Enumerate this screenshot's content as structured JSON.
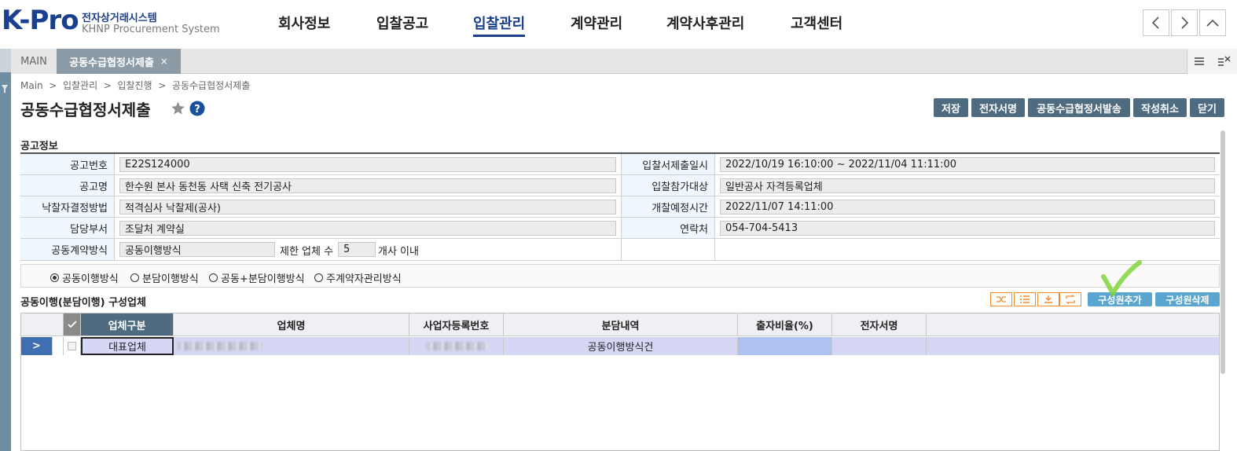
{
  "header": {
    "logo_main": "K-Pro",
    "logo_kr": "전자상거래시스템",
    "logo_en": "KHNP Procurement System",
    "nav": [
      "회사정보",
      "입찰공고",
      "입찰관리",
      "계약관리",
      "계약사후관리",
      "고객센터"
    ],
    "active_nav": "입찰관리"
  },
  "tabs": {
    "main": "MAIN",
    "active": "공동수급협정서제출",
    "close": "×"
  },
  "breadcrumb": "Main  >  입찰관리  >  입찰진행  >  공동수급협정서제출",
  "page_title": "공동수급협정서제출",
  "toolbar": {
    "save": "저장",
    "esign": "전자서명",
    "send": "공동수급협정서발송",
    "cancel": "작성취소",
    "close": "닫기"
  },
  "notice_section": "공고정보",
  "notice": {
    "no_label": "공고번호",
    "no_value": "E22S124000",
    "name_label": "공고명",
    "name_value": "한수원 본사 동천동 사택 신축 전기공사",
    "method_label": "낙찰자결정방법",
    "method_value": "적격심사 낙찰제(공사)",
    "dept_label": "담당부서",
    "dept_value": "조달처 계약실",
    "joint_label": "공동계약방식",
    "joint_value": "공동이행방식",
    "limit_prefix": "제한 업체 수",
    "limit_value": "5",
    "limit_suffix": "개사 이내",
    "period_label": "입찰서제출일시",
    "period_value": "2022/10/19 16:10:00 ~ 2022/11/04 11:11:00",
    "target_label": "입찰참가대상",
    "target_value": "일반공사 자격등록업체",
    "open_label": "개찰예정시간",
    "open_value": "2022/11/07 14:11:00",
    "contact_label": "연락처",
    "contact_value": "054-704-5413"
  },
  "radios": [
    {
      "label": "공동이행방식",
      "checked": true
    },
    {
      "label": "분담이행방식",
      "checked": false
    },
    {
      "label": "공동+분담이행방식",
      "checked": false
    },
    {
      "label": "주계약자관리방식",
      "checked": false
    }
  ],
  "members_section": "공동이행(분담이행) 구성업체",
  "member_buttons": {
    "add": "구성원추가",
    "delete": "구성원삭제"
  },
  "grid": {
    "columns": [
      "업체구분",
      "업체명",
      "사업자등록번호",
      "분담내역",
      "출자비율(%)",
      "전자서명"
    ],
    "rows": [
      {
        "expand": ">",
        "type": "대표업체",
        "name": "",
        "biz_no": "",
        "share": "공동이행방식건",
        "ratio": "",
        "esign": ""
      }
    ]
  },
  "colors": {
    "brand": "#1b3f8f",
    "button": "#4f6b80",
    "add_button": "#5ba6d0",
    "orange": "#f08c2c",
    "check_mark": "#7fd33a"
  }
}
